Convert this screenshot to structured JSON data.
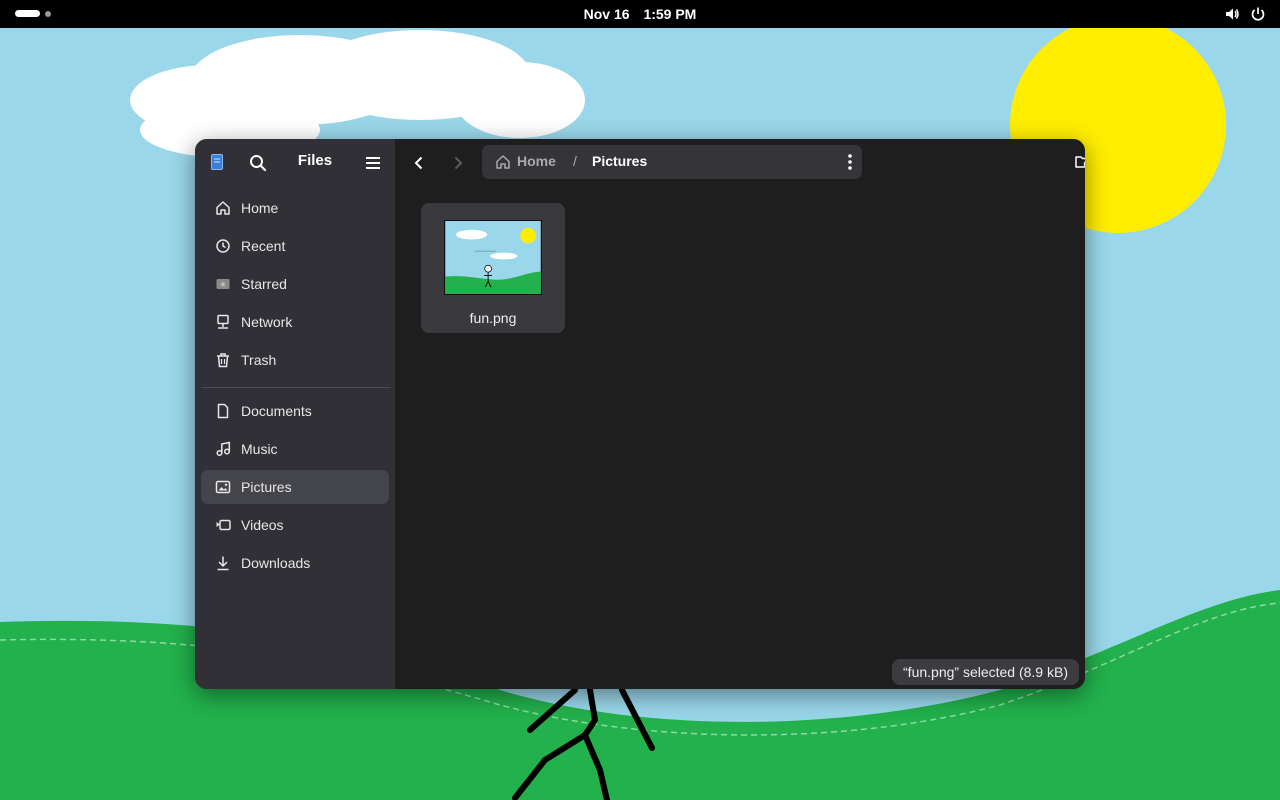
{
  "topbar": {
    "date": "Nov 16",
    "time": "1:59 PM",
    "icons": [
      "volume-icon",
      "power-icon"
    ]
  },
  "window": {
    "app_title": "Files",
    "sidebar": {
      "places": [
        {
          "label": "Home",
          "icon": "home-icon"
        },
        {
          "label": "Recent",
          "icon": "clock-icon"
        },
        {
          "label": "Starred",
          "icon": "star-icon"
        },
        {
          "label": "Network",
          "icon": "network-icon"
        },
        {
          "label": "Trash",
          "icon": "trash-icon"
        }
      ],
      "bookmarks": [
        {
          "label": "Documents",
          "icon": "document-icon"
        },
        {
          "label": "Music",
          "icon": "music-icon"
        },
        {
          "label": "Pictures",
          "icon": "pictures-icon",
          "active": true
        },
        {
          "label": "Videos",
          "icon": "video-icon"
        },
        {
          "label": "Downloads",
          "icon": "download-icon"
        }
      ]
    },
    "path": {
      "home": "Home",
      "separator": "/",
      "current": "Pictures"
    },
    "files": [
      {
        "name": "fun.png",
        "selected": true
      }
    ],
    "status": "“fun.png” selected  (8.9 kB)"
  },
  "colors": {
    "sky": "#9ad7ea",
    "grass": "#22b14c",
    "sun": "#ffee00",
    "window_bg": "#1e1e1e",
    "sidebar_bg": "#303036"
  }
}
